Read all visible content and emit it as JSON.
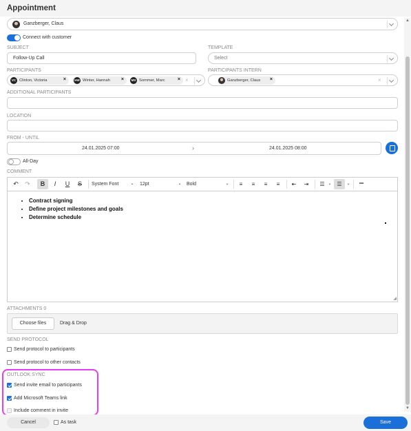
{
  "window": {
    "title": "Appointment"
  },
  "contact": {
    "name": "Ganzberger, Claus"
  },
  "connect": {
    "label": "Connect with customer",
    "on": true
  },
  "subject": {
    "label": "SUBJECT",
    "value": "Follow-Up Call"
  },
  "template": {
    "label": "TEMPLATE",
    "placeholder": "Select"
  },
  "participants": {
    "label": "PARTICIPANTS",
    "chips": [
      {
        "initials": "VC",
        "name": "Clinton, Victoria"
      },
      {
        "initials": "HW",
        "name": "Winter, Hannah"
      },
      {
        "initials": "MS",
        "name": "Sommer, Marc"
      }
    ]
  },
  "participants_intern": {
    "label": "PARTICIPANTS INTERN",
    "chip": "Ganzberger, Claus"
  },
  "additional": {
    "label": "ADDITIONAL PARTICIPANTS",
    "value": ""
  },
  "location": {
    "label": "LOCATION",
    "value": ""
  },
  "from_until": {
    "label": "FROM - UNTIL",
    "from": "24.01.2025 07:00",
    "until": "24.01.2025 08:00",
    "separator": "›"
  },
  "allday": {
    "label": "All-Day",
    "on": false
  },
  "comment": {
    "label": "COMMENT",
    "toolbar": {
      "undo": "↶",
      "redo": "↷",
      "bold": "B",
      "italic": "I",
      "underline": "U",
      "strike": "S",
      "font": "System Font",
      "size": "12pt",
      "format": "Bold",
      "more": "•••"
    },
    "bullets": [
      "Contract signing",
      "Define project milestones and goals",
      "Determine schedule"
    ]
  },
  "attachments": {
    "label": "ATTACHMENTS 0",
    "choose": "Choose files",
    "drag": "Drag & Drop"
  },
  "send_protocol": {
    "label": "SEND PROTOCOL",
    "to_participants": "Send protocol to participants",
    "to_others": "Send protocol to other contacts"
  },
  "outlook": {
    "label": "OUTLOOK SYNC",
    "invite_email": {
      "label": "Send invite email to participants",
      "checked": true
    },
    "teams_link": {
      "label": "Add Microsoft Teams link",
      "checked": true
    },
    "include_comment": {
      "label": "Include comment in invite",
      "checked": false
    }
  },
  "footer": {
    "cancel": "Cancel",
    "as_task": "As task",
    "save": "Save"
  },
  "colors": {
    "accent": "#1b6fd9",
    "highlight": "#e83cf0"
  }
}
